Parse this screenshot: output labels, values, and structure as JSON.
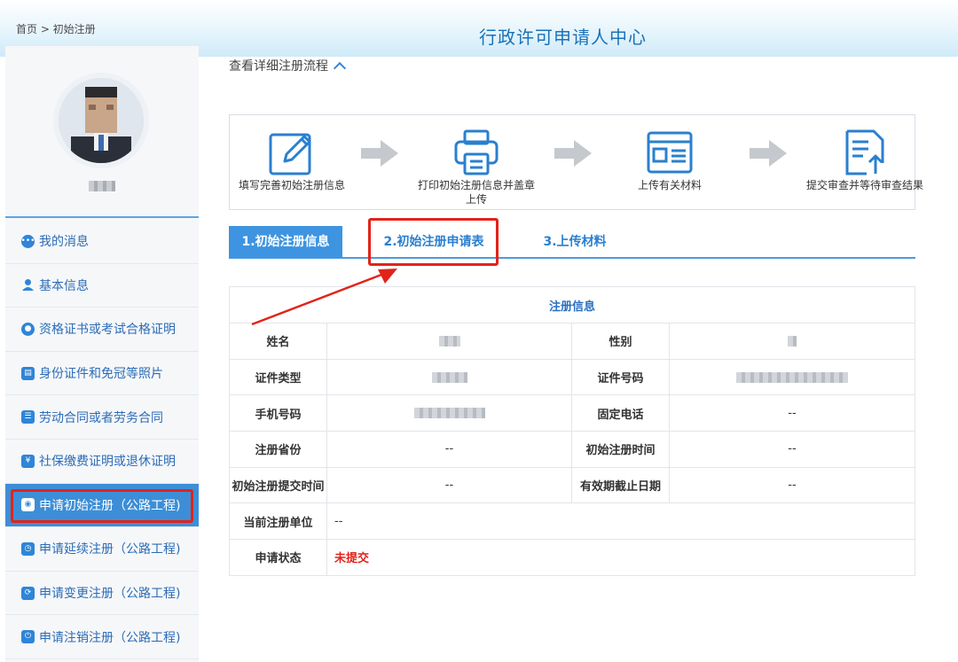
{
  "header": {
    "breadcrumb": "首页 > 初始注册",
    "title": "行政许可申请人中心"
  },
  "sidebar": {
    "items": [
      {
        "label": "我的消息",
        "icon": "message-icon"
      },
      {
        "label": "基本信息",
        "icon": "person-icon"
      },
      {
        "label": "资格证书或考试合格证明",
        "icon": "certificate-icon"
      },
      {
        "label": "身份证件和免冠等照片",
        "icon": "id-card-icon"
      },
      {
        "label": "劳动合同或者劳务合同",
        "icon": "contract-icon"
      },
      {
        "label": "社保缴费证明或退休证明",
        "icon": "social-security-icon"
      },
      {
        "label": "申请初始注册（公路工程)",
        "icon": "camera-icon",
        "active": true
      },
      {
        "label": "申请延续注册（公路工程)",
        "icon": "clock-icon"
      },
      {
        "label": "申请变更注册（公路工程)",
        "icon": "change-icon"
      },
      {
        "label": "申请注销注册（公路工程)",
        "icon": "power-icon"
      }
    ]
  },
  "flow": {
    "toggle_label": "查看详细注册流程",
    "steps": [
      {
        "label": "填写完善初始注册信息",
        "icon": "edit-icon"
      },
      {
        "label": "打印初始注册信息并盖章上传",
        "icon": "printer-icon"
      },
      {
        "label": "上传有关材料",
        "icon": "document-icon"
      },
      {
        "label": "提交审查并等待审查结果",
        "icon": "submit-icon"
      }
    ]
  },
  "tabs": [
    {
      "label": "1.初始注册信息",
      "active": true
    },
    {
      "label": "2.初始注册申请表"
    },
    {
      "label": "3.上传材料"
    }
  ],
  "table": {
    "caption": "注册信息",
    "rows": [
      {
        "label1": "姓名",
        "value1": "",
        "label2": "性别",
        "value2": ""
      },
      {
        "label1": "证件类型",
        "value1": "",
        "label2": "证件号码",
        "value2": ""
      },
      {
        "label1": "手机号码",
        "value1": "",
        "label2": "固定电话",
        "value2": "--"
      },
      {
        "label1": "注册省份",
        "value1": "--",
        "label2": "初始注册时间",
        "value2": "--"
      },
      {
        "label1": "初始注册提交时间",
        "value1": "--",
        "label2": "有效期截止日期",
        "value2": "--"
      }
    ],
    "unit_label": "当前注册单位",
    "unit_value": "--",
    "status_label": "申请状态",
    "status_value": "未提交"
  },
  "colors": {
    "accent": "#3e94e0",
    "highlight": "#e2231a",
    "status_red": "#e2231a"
  }
}
